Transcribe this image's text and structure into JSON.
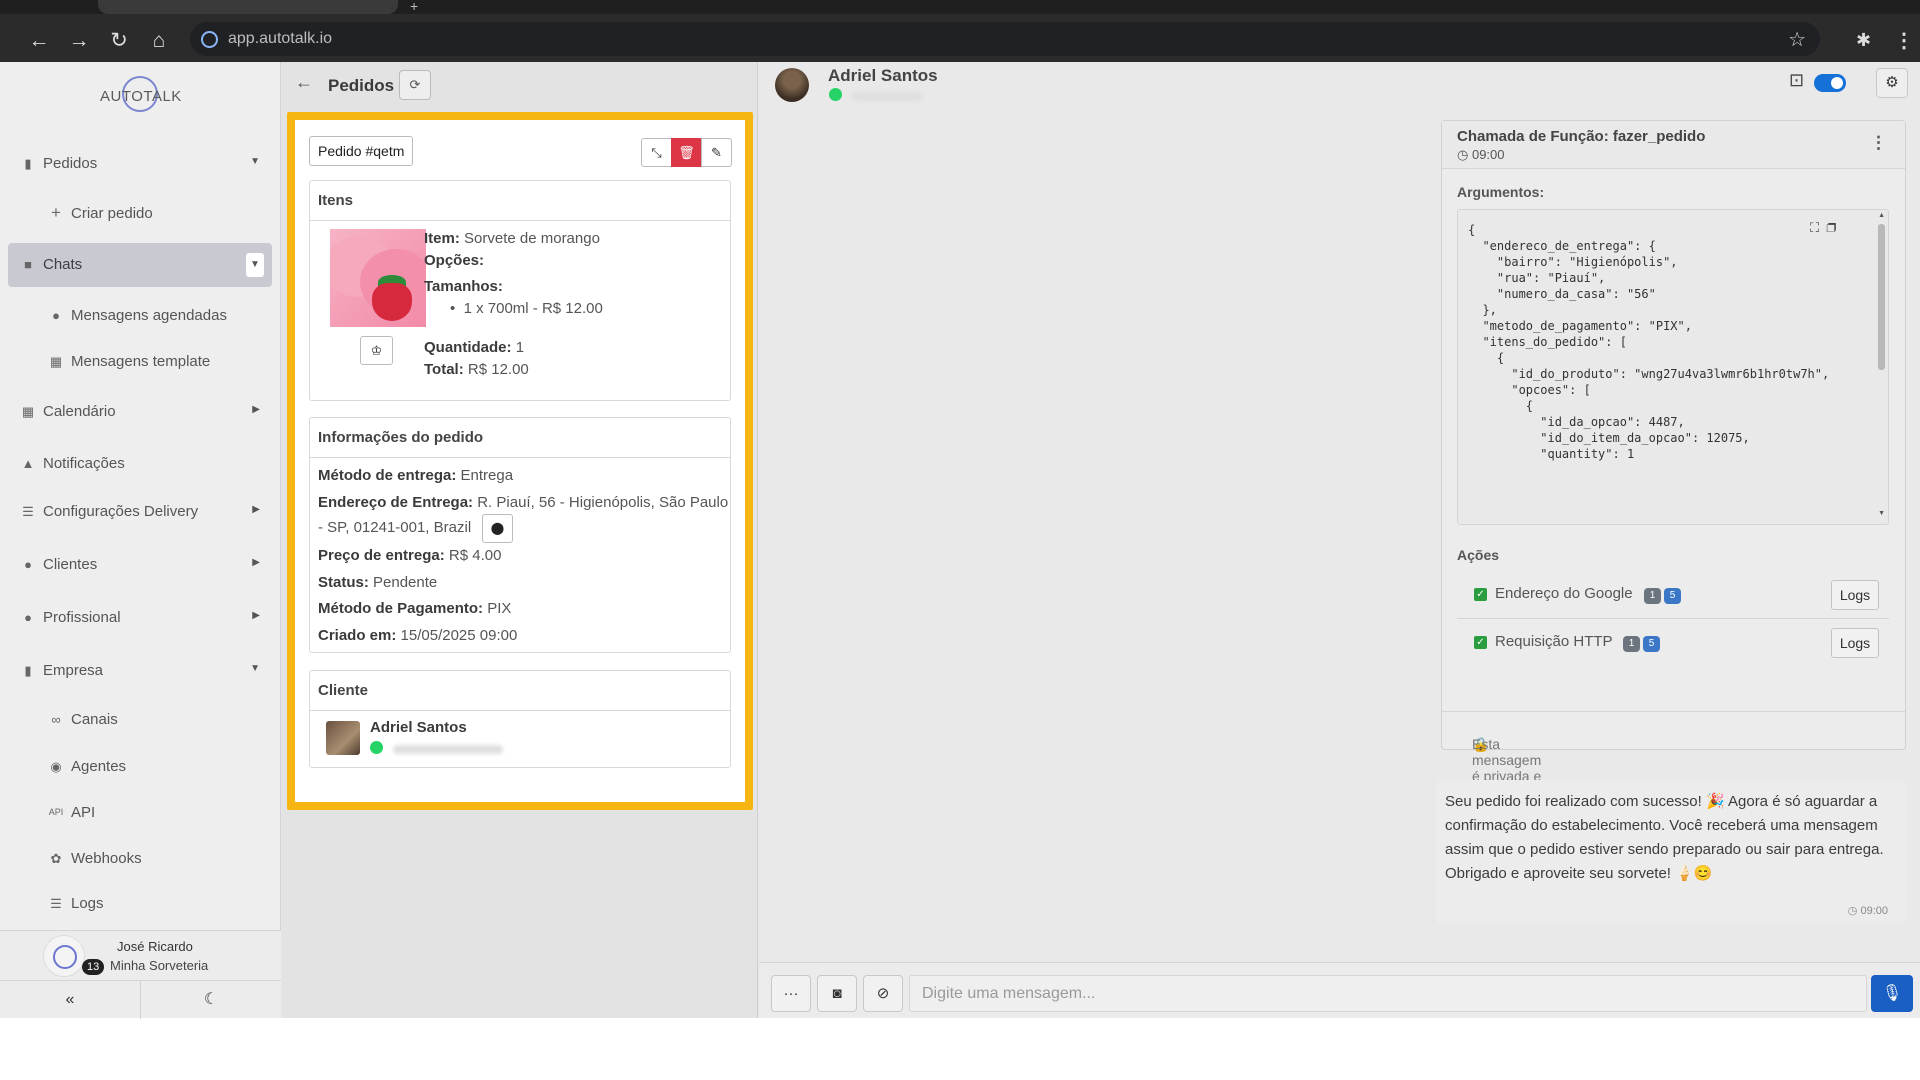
{
  "browser": {
    "url": "app.autotalk.io"
  },
  "sidebar": {
    "logo_text": "AUTOTALK",
    "items": [
      {
        "label": "Pedidos",
        "icon": "clipboard-icon"
      },
      {
        "label": "Criar pedido",
        "icon": "plus-icon"
      },
      {
        "label": "Chats",
        "icon": "chat-icon"
      },
      {
        "label": "Mensagens agendadas",
        "icon": "clock-icon"
      },
      {
        "label": "Mensagens template",
        "icon": "template-icon"
      },
      {
        "label": "Calendário",
        "icon": "calendar-icon"
      },
      {
        "label": "Notificações",
        "icon": "bell-icon"
      },
      {
        "label": "Configurações Delivery",
        "icon": "sliders-icon"
      },
      {
        "label": "Clientes",
        "icon": "users-icon"
      },
      {
        "label": "Profissional",
        "icon": "user-tie-icon"
      },
      {
        "label": "Empresa",
        "icon": "building-icon"
      },
      {
        "label": "Canais",
        "icon": "link-icon"
      },
      {
        "label": "Agentes",
        "icon": "robot-icon"
      },
      {
        "label": "API",
        "icon": "api-icon"
      },
      {
        "label": "Webhooks",
        "icon": "webhook-icon"
      },
      {
        "label": "Logs",
        "icon": "list-icon"
      }
    ],
    "profile": {
      "name": "José Ricardo",
      "company": "Minha Sorveteria",
      "badge": "13"
    }
  },
  "orders": {
    "title": "Pedidos",
    "order_label": "Pedido #qetm",
    "items_panel": {
      "title": "Itens",
      "item_label": "Item:",
      "item_value": "Sorvete de morango",
      "options_label": "Opções:",
      "sizes_label": "Tamanhos:",
      "size_line": "1 x 700ml - R$ 12.00",
      "quantity_label": "Quantidade:",
      "quantity_value": "1",
      "total_label": "Total:",
      "total_value": "R$ 12.00"
    },
    "info_panel": {
      "title": "Informações do pedido",
      "delivery_method_label": "Método de entrega:",
      "delivery_method_value": "Entrega",
      "address_label": "Endereço de Entrega:",
      "address_line1": "R. Piauí, 56 - Higienópolis, São Paulo",
      "address_line2": "- SP, 01241-001, Brazil",
      "delivery_price_label": "Preço de entrega:",
      "delivery_price_value": "R$ 4.00",
      "status_label": "Status:",
      "status_value": "Pendente",
      "payment_label": "Método de Pagamento:",
      "payment_value": "PIX",
      "created_label": "Criado em:",
      "created_value": "15/05/2025 09:00"
    },
    "client_panel": {
      "title": "Cliente",
      "name": "Adriel Santos"
    }
  },
  "chat": {
    "contact_name": "Adriel Santos",
    "function_card": {
      "title": "Chamada de Função: fazer_pedido",
      "time": "09:00",
      "args_label": "Argumentos:",
      "code": "{\n  \"endereco_de_entrega\": {\n    \"bairro\": \"Higienópolis\",\n    \"rua\": \"Piauí\",\n    \"numero_da_casa\": \"56\"\n  },\n  \"metodo_de_pagamento\": \"PIX\",\n  \"itens_do_pedido\": [\n    {\n      \"id_do_produto\": \"wng27u4va3lwmr6b1hr0tw7h\",\n      \"opcoes\": [\n        {\n          \"id_da_opcao\": 4487,\n          \"id_do_item_da_opcao\": 12075,\n          \"quantity\": 1",
      "actions_label": "Ações",
      "actions": [
        {
          "label": "Endereço do Google",
          "a": "1",
          "b": "5",
          "button": "Logs"
        },
        {
          "label": "Requisição HTTP",
          "a": "1",
          "b": "5",
          "button": "Logs"
        }
      ],
      "private_note": "Esta mensagem é privada e visível apenas para você."
    },
    "message": {
      "text": "Seu pedido foi realizado com sucesso! 🎉 Agora é só aguardar a confirmação do estabelecimento. Você receberá uma mensagem assim que o pedido estiver sendo preparado ou sair para entrega. Obrigado e aproveite seu sorvete! 🍦😊",
      "time": "09:00"
    },
    "composer": {
      "placeholder": "Digite uma mensagem..."
    }
  },
  "colors": {
    "highlight": "#f7b512",
    "accent": "#1a5fc4",
    "danger": "#dc3545",
    "whatsapp": "#25d366"
  }
}
